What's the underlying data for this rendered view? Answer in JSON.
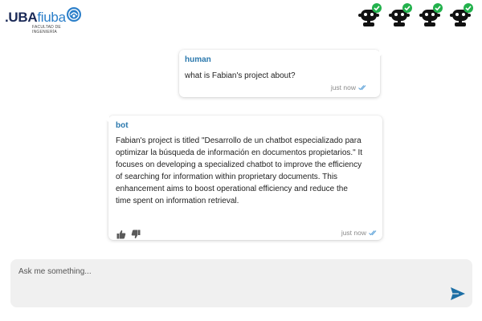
{
  "header": {
    "logo": {
      "part1": ".UBA",
      "part2": "fiuba",
      "subtitle": "Facultad de Ingeniería"
    },
    "bot_statuses": [
      {
        "icon": "robot-online-icon",
        "status_color": "#22b14c"
      },
      {
        "icon": "robot-online-icon",
        "status_color": "#22b14c"
      },
      {
        "icon": "robot-online-icon",
        "status_color": "#22b14c"
      },
      {
        "icon": "robot-online-icon",
        "status_color": "#22b14c"
      }
    ]
  },
  "messages": [
    {
      "sender": "human",
      "text": "what is Fabian's project about?",
      "time": "just now",
      "read_icon": "double-check-icon"
    },
    {
      "sender": "bot",
      "text": "Fabian's project is titled \"Desarrollo de un chatbot especializado para optimizar la búsqueda de información en documentos propietarios.\" It focuses on developing a specialized chatbot to improve the efficiency of searching for information within proprietary documents. This enhancement aims to boost operational efficiency and reduce the time spent on information retrieval.",
      "time": "just now",
      "read_icon": "double-check-icon",
      "feedback": {
        "like_icon": "thumbs-up-icon",
        "dislike_icon": "thumbs-down-icon"
      }
    }
  ],
  "composer": {
    "placeholder": "Ask me something...",
    "value": "",
    "send_icon": "send-icon"
  },
  "colors": {
    "sender_name": "#2a78ad",
    "status_online": "#22b14c",
    "send_button": "#1d6fa5",
    "read_ticks": "#5aa0d8"
  }
}
